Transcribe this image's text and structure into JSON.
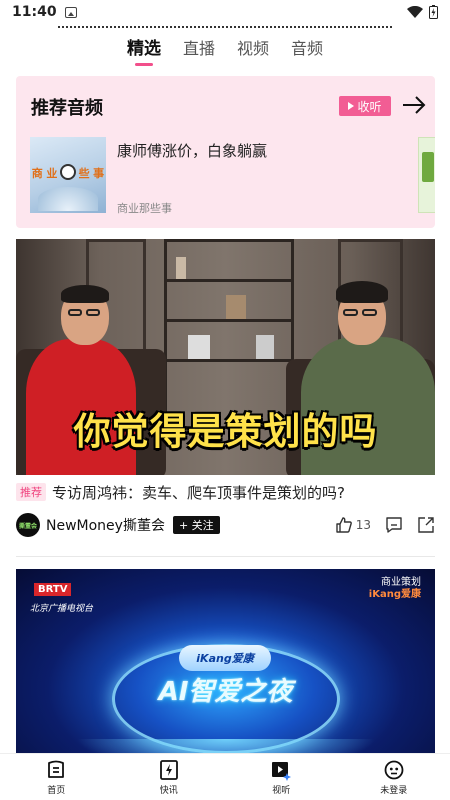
{
  "status_bar": {
    "time": "11:40"
  },
  "tabs": [
    {
      "label": "精选",
      "active": true
    },
    {
      "label": "直播",
      "active": false
    },
    {
      "label": "视频",
      "active": false
    },
    {
      "label": "音频",
      "active": false
    }
  ],
  "audio_section": {
    "title": "推荐音频",
    "collect_label": "收听",
    "podcast": {
      "title": "康师傅涨价，白象躺赢",
      "source": "商业那些事",
      "cover_text": [
        "商",
        "业",
        "些",
        "事"
      ]
    }
  },
  "article": {
    "caption": "你觉得是策划的吗",
    "badge": "推荐",
    "title": "专访周鸿祎：卖车、爬车顶事件是策划的吗?",
    "author": "NewMoney撕董会",
    "avatar_text": "撕董会",
    "follow_label": "+ 关注",
    "likes": "13"
  },
  "video2": {
    "brtv": "BRTV",
    "station": "北京广播电视台",
    "top_right_line1": "商业策划",
    "top_right_brand": "iKang爱康",
    "cloud_text": "iKang爱康",
    "headline": "AI智爱之夜"
  },
  "bottom_nav": [
    {
      "label": "首页",
      "icon": "home-icon"
    },
    {
      "label": "快讯",
      "icon": "flash-icon"
    },
    {
      "label": "视听",
      "icon": "video-icon"
    },
    {
      "label": "未登录",
      "icon": "user-icon"
    }
  ],
  "colors": {
    "accent": "#f24f8b",
    "audio_bg": "#fde6ee",
    "caption": "#ffe24a"
  }
}
